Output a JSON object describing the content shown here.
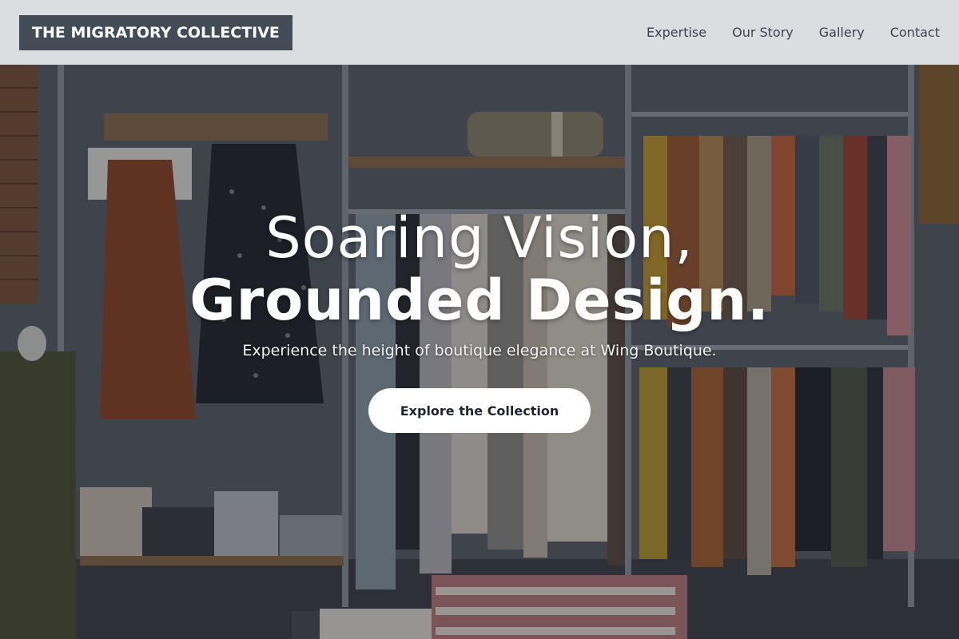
{
  "navbar": {
    "brand": "THE MIGRATORY COLLECTIVE",
    "links": [
      {
        "label": "Expertise"
      },
      {
        "label": "Our Story"
      },
      {
        "label": "Gallery"
      },
      {
        "label": "Contact"
      }
    ]
  },
  "hero": {
    "headline_line1": "Soaring Vision,",
    "headline_line2": "Grounded Design.",
    "subtitle": "Experience the height of boutique elegance at Wing Boutique.",
    "cta_label": "Explore the Collection",
    "background_image": "boutique-clothing-racks-photo"
  },
  "colors": {
    "navbar_bg": "#e2e4e7",
    "brand_bg": "#434b57",
    "brand_text": "#ffffff",
    "nav_text": "#3c4350",
    "cta_bg": "#ffffff",
    "cta_text": "#1f2430",
    "hero_text": "#ffffff"
  }
}
